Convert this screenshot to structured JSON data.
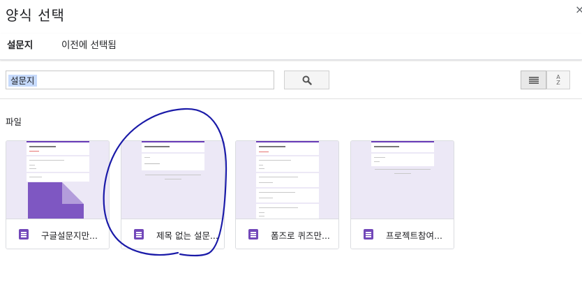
{
  "dialog": {
    "title": "양식 선택",
    "close_glyph": "×"
  },
  "tabs": [
    {
      "label": "설문지",
      "active": true
    },
    {
      "label": "이전에 선택됨",
      "active": false
    }
  ],
  "search": {
    "value": "설문지",
    "search_icon": "search-icon"
  },
  "view": {
    "list_icon": "list-view-icon",
    "sort_icon": "sort-az-icon",
    "sort_top": "A",
    "sort_bottom": "Z"
  },
  "section": {
    "label": "파일"
  },
  "files": [
    {
      "name": "구글설문지만...",
      "thumb_title": "구글설문지만들기",
      "icon": "google-forms-icon"
    },
    {
      "name": "제목 없는 설문...",
      "thumb_title": "제목 없는 설문지",
      "icon": "google-forms-icon"
    },
    {
      "name": "폼즈로 퀴즈만...",
      "thumb_title": "폼즈로 퀴즈만들기",
      "icon": "google-forms-icon"
    },
    {
      "name": "프로젝트참여...",
      "thumb_title": "제목 없는 설문지",
      "icon": "google-forms-icon"
    }
  ],
  "colors": {
    "accent": "#673ab7",
    "form_icon": "#7248b9",
    "thumb_bg": "#ece8f6",
    "annotation": "#1a1aa8"
  }
}
